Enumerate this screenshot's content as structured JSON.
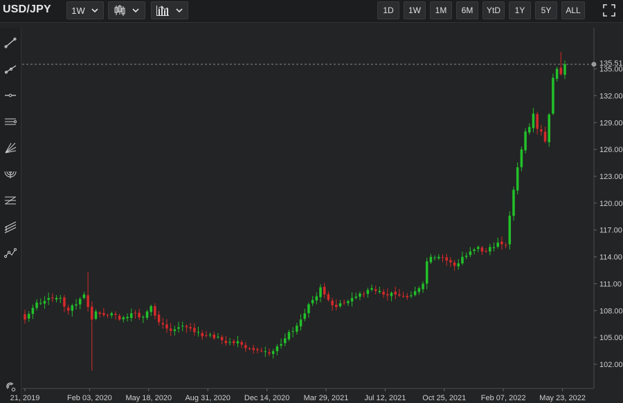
{
  "header": {
    "symbol": "USD/JPY",
    "interval": "1W",
    "ranges": [
      "1D",
      "1W",
      "1M",
      "6M",
      "YtD",
      "1Y",
      "5Y",
      "ALL"
    ]
  },
  "icons": {
    "chart_type": "candlestick-icon",
    "indicators": "bar-chart-icon",
    "expand": "fullscreen-icon",
    "tools": [
      "trend-line-icon",
      "ray-line-icon",
      "horizontal-line-icon",
      "parallel-channel-icon",
      "fan-lines-icon",
      "fibonacci-arcs-icon",
      "fibonacci-retracement-icon",
      "pitchfork-icon",
      "polyline-icon"
    ],
    "bottom_tool": "magnet-icon"
  },
  "chart_data": {
    "type": "candlestick",
    "y_axis": {
      "ticks": [
        135.0,
        132.0,
        129.0,
        126.0,
        123.0,
        120.0,
        117.0,
        114.0,
        111.0,
        108.0,
        105.0,
        102.0
      ],
      "tick_labels": [
        "135.00",
        "132.00",
        "129.00",
        "126.00",
        "123.00",
        "120.00",
        "117.00",
        "114.00",
        "111.00",
        "108.00",
        "105.00",
        "102.00"
      ],
      "range": [
        99.3,
        139.6
      ]
    },
    "x_axis": {
      "tick_labels": [
        "21, 2019",
        "Feb 03, 2020",
        "May 18, 2020",
        "Aug 31, 2020",
        "Dec 14, 2020",
        "Mar 29, 2021",
        "Jul 12, 2021",
        "Oct 25, 2021",
        "Feb 07, 2022",
        "May 23, 2022"
      ],
      "tick_index": [
        0,
        15,
        30,
        45,
        60,
        75,
        90,
        105,
        120,
        135
      ]
    },
    "last_price": 135.51,
    "last_price_label": "135.51",
    "colors": {
      "up": "#22c02a",
      "down": "#d42a2a",
      "last_line": "#8a8a8a"
    },
    "anchors": [
      [
        0,
        107.0
      ],
      [
        3,
        108.9
      ],
      [
        6,
        109.4
      ],
      [
        9,
        109.4
      ],
      [
        11,
        108.0
      ],
      [
        13,
        108.7
      ],
      [
        15,
        109.8
      ],
      [
        16,
        108.4
      ],
      [
        17,
        107.0
      ],
      [
        18,
        107.9
      ],
      [
        20,
        107.5
      ],
      [
        22,
        107.7
      ],
      [
        24,
        107.0
      ],
      [
        26,
        107.3
      ],
      [
        27,
        107.7
      ],
      [
        28,
        107.7
      ],
      [
        30,
        107.3
      ],
      [
        32,
        108.5
      ],
      [
        34,
        106.7
      ],
      [
        36,
        106.0
      ],
      [
        38,
        105.9
      ],
      [
        40,
        106.3
      ],
      [
        42,
        106.0
      ],
      [
        44,
        105.6
      ],
      [
        46,
        105.2
      ],
      [
        48,
        104.9
      ],
      [
        50,
        104.7
      ],
      [
        52,
        104.5
      ],
      [
        55,
        104.2
      ],
      [
        58,
        103.6
      ],
      [
        60,
        103.5
      ],
      [
        62,
        103.2
      ],
      [
        64,
        104.0
      ],
      [
        66,
        104.9
      ],
      [
        68,
        105.7
      ],
      [
        70,
        107.0
      ],
      [
        72,
        108.7
      ],
      [
        74,
        109.6
      ],
      [
        75,
        110.6
      ],
      [
        77,
        109.2
      ],
      [
        79,
        108.4
      ],
      [
        81,
        108.9
      ],
      [
        83,
        109.4
      ],
      [
        85,
        109.9
      ],
      [
        87,
        110.3
      ],
      [
        89,
        110.2
      ],
      [
        90,
        110.2
      ],
      [
        92,
        109.7
      ],
      [
        94,
        109.8
      ],
      [
        96,
        109.6
      ],
      [
        98,
        109.7
      ],
      [
        100,
        110.5
      ],
      [
        101,
        111.0
      ],
      [
        102,
        113.5
      ],
      [
        103,
        114.0
      ],
      [
        105,
        114.0
      ],
      [
        107,
        113.6
      ],
      [
        109,
        113.0
      ],
      [
        111,
        114.0
      ],
      [
        113,
        114.6
      ],
      [
        115,
        115.1
      ],
      [
        116,
        114.6
      ],
      [
        118,
        115.1
      ],
      [
        120,
        115.6
      ],
      [
        122,
        115.3
      ],
      [
        123,
        118.6
      ],
      [
        124,
        121.5
      ],
      [
        125,
        124.0
      ],
      [
        126,
        126.0
      ],
      [
        127,
        128.0
      ],
      [
        128,
        128.5
      ],
      [
        129,
        130.0
      ],
      [
        130,
        128.3
      ],
      [
        131,
        128.0
      ],
      [
        132,
        126.9
      ],
      [
        133,
        129.9
      ],
      [
        134,
        134.0
      ],
      [
        135,
        135.0
      ],
      [
        136,
        134.4
      ],
      [
        137,
        135.51
      ]
    ]
  }
}
